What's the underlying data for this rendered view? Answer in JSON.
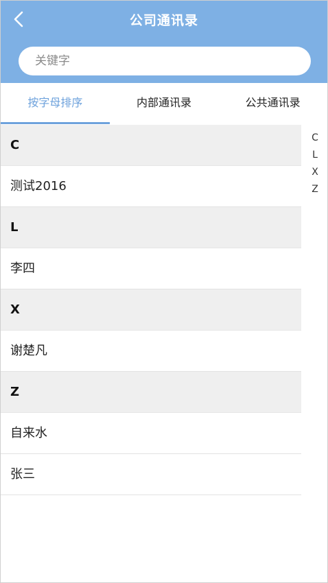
{
  "header": {
    "title": "公司通讯录",
    "back_icon": "chevron-left-icon",
    "background_color": "#7eb0e4"
  },
  "search": {
    "placeholder": "关键字",
    "value": ""
  },
  "tabs": [
    {
      "label": "按字母排序",
      "active": true
    },
    {
      "label": "内部通讯录",
      "active": false
    },
    {
      "label": "公共通讯录",
      "active": false
    }
  ],
  "accent_color": "#6ea2dc",
  "groups": [
    {
      "letter": "C",
      "contacts": [
        "测试2016"
      ]
    },
    {
      "letter": "L",
      "contacts": [
        "李四"
      ]
    },
    {
      "letter": "X",
      "contacts": [
        "谢楚凡"
      ]
    },
    {
      "letter": "Z",
      "contacts": [
        "自来水",
        "张三"
      ]
    }
  ],
  "index_letters": [
    "C",
    "L",
    "X",
    "Z"
  ]
}
